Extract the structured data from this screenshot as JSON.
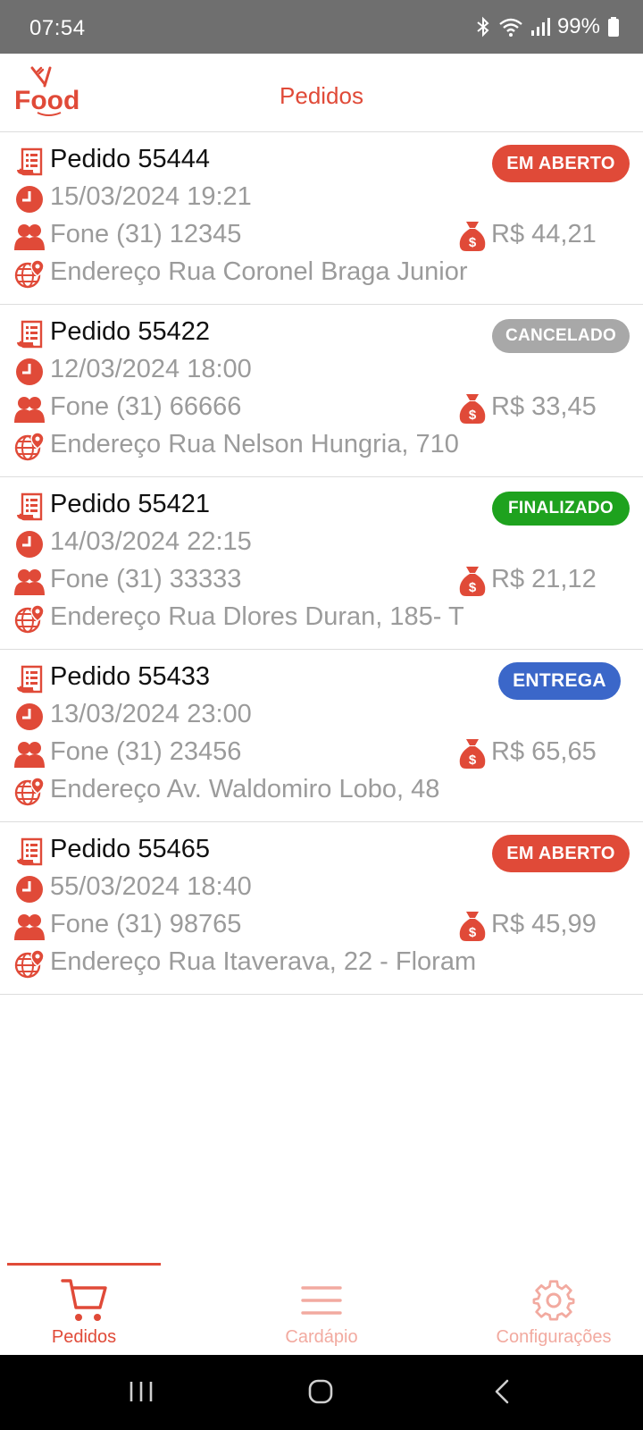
{
  "status_bar": {
    "time": "07:54",
    "battery": "99%",
    "icons": [
      "bluetooth-icon",
      "wifi-icon",
      "signal-icon",
      "battery-icon"
    ]
  },
  "header": {
    "logo_text": "Food",
    "title": "Pedidos"
  },
  "colors": {
    "brand": "#e04a38",
    "em_aberto": "#e04a38",
    "cancelado": "#a8a8a8",
    "finalizado": "#1ea21e",
    "entrega": "#3b67c9"
  },
  "orders": [
    {
      "number": "Pedido 55444",
      "datetime": "15/03/2024 19:21",
      "phone": "Fone (31) 12345",
      "total": "R$ 44,21",
      "address": "Endereço Rua Coronel Braga Junior",
      "status": "EM ABERTO",
      "status_color": "#e04a38"
    },
    {
      "number": "Pedido 55422",
      "datetime": "12/03/2024 18:00",
      "phone": "Fone (31) 66666",
      "total": "R$ 33,45",
      "address": "Endereço Rua Nelson Hungria, 710",
      "status": "CANCELADO",
      "status_color": "#a8a8a8"
    },
    {
      "number": "Pedido 55421",
      "datetime": "14/03/2024 22:15",
      "phone": "Fone (31) 33333",
      "total": "R$ 21,12",
      "address": "Endereço Rua Dlores Duran, 185- T",
      "status": "FINALIZADO",
      "status_color": "#1ea21e"
    },
    {
      "number": "Pedido 55433",
      "datetime": "13/03/2024 23:00",
      "phone": "Fone (31) 23456",
      "total": "R$ 65,65",
      "address": "Endereço Av. Waldomiro Lobo, 48",
      "status": "ENTREGA",
      "status_color": "#3b67c9"
    },
    {
      "number": "Pedido 55465",
      "datetime": "55/03/2024 18:40",
      "phone": "Fone (31) 98765",
      "total": "R$ 45,99",
      "address": "Endereço Rua Itaverava, 22 - Floram",
      "status": "EM ABERTO",
      "status_color": "#e04a38"
    }
  ],
  "bottom_nav": {
    "items": [
      {
        "label": "Pedidos",
        "icon": "cart-icon",
        "active": true
      },
      {
        "label": "Cardápio",
        "icon": "menu-icon",
        "active": false
      },
      {
        "label": "Configurações",
        "icon": "gear-icon",
        "active": false
      }
    ]
  },
  "system_nav": {
    "buttons": [
      "recent-apps-icon",
      "home-icon",
      "back-icon"
    ]
  }
}
